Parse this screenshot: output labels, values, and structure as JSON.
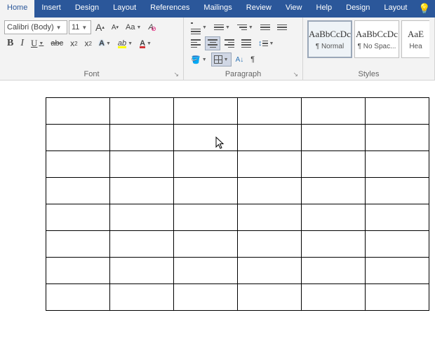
{
  "menubar": {
    "tabs": [
      "Home",
      "Insert",
      "Design",
      "Layout",
      "References",
      "Mailings",
      "Review",
      "View",
      "Help",
      "Design",
      "Layout"
    ],
    "active_index": 0
  },
  "font_group": {
    "label": "Font",
    "font_name": "Calibri (Body)",
    "font_size": "11",
    "grow": "A",
    "shrink": "A",
    "change_case": "Aa",
    "bold": "B",
    "italic": "I",
    "underline": "U",
    "strike": "abc",
    "subscript_base": "x",
    "subscript_sub": "2",
    "superscript_base": "x",
    "superscript_sup": "2",
    "text_effects": "A",
    "highlight_letter": "ab",
    "font_color_letter": "A",
    "highlight_color": "#ffff00",
    "font_color": "#d13438",
    "effects_color": "#2e75b6",
    "clear_formatting_glyph": "A⊘"
  },
  "paragraph_group": {
    "label": "Paragraph",
    "pilcrow": "¶",
    "sort": "A↓"
  },
  "styles_group": {
    "label": "Styles",
    "items": [
      {
        "preview": "AaBbCcDc",
        "name": "¶ Normal"
      },
      {
        "preview": "AaBbCcDc",
        "name": "¶ No Spac..."
      },
      {
        "preview": "AaE",
        "name": "Hea"
      }
    ],
    "selected_index": 0
  },
  "document": {
    "table_rows": 8,
    "table_cols": 6
  }
}
